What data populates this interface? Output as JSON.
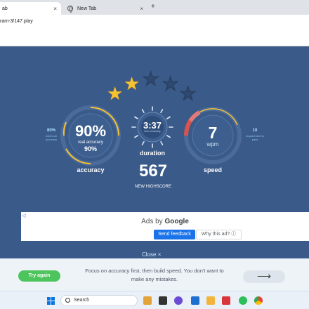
{
  "browser": {
    "active_tab_title": "ab",
    "inactive_tab_title": "New Tab",
    "close_glyph": "×",
    "new_tab_glyph": "+",
    "url": "ram-3/147.play"
  },
  "results": {
    "stars": {
      "earned": 2,
      "total": 5
    },
    "accuracy": {
      "value": "90%",
      "real_label": "real accuracy",
      "real_value": "90%",
      "label": "accuracy",
      "minimum_value": "80%",
      "minimum_label": "minimum accuracy",
      "fill_fraction": 0.9
    },
    "duration": {
      "value": "3:37",
      "sub_label": "time remaining",
      "label": "duration"
    },
    "speed": {
      "value": "7",
      "unit": "wpm",
      "label": "speed",
      "requirement_value": "10",
      "requirement_label_1": "requirement to",
      "requirement_label_2": "pass"
    },
    "score": "567",
    "score_label": "NEW HIGHSCORE",
    "close_label": "Close",
    "close_icon": "×"
  },
  "ad": {
    "info_glyph": "◁",
    "ads_by": "Ads by",
    "brand": "Google",
    "feedback_label": "Send feedback",
    "why_label": "Why this ad? ⓘ"
  },
  "footer": {
    "try_again": "Try again",
    "tip_line1": "Focus on accuracy first, then build speed. You don't want to",
    "tip_line2": "make any mistakes.",
    "next_glyph": "⟶"
  },
  "taskbar": {
    "search_label": "Search"
  },
  "colors": {
    "background": "#3a5a89",
    "gauge_track": "#4b6c9b",
    "gold": "#f6c132",
    "red": "#d9534f",
    "accent_blue": "#8fc6ea"
  },
  "icons": [
    "globe-icon",
    "star-icon",
    "close-icon",
    "info-icon",
    "arrow-right-icon",
    "windows-icon",
    "search-icon"
  ]
}
